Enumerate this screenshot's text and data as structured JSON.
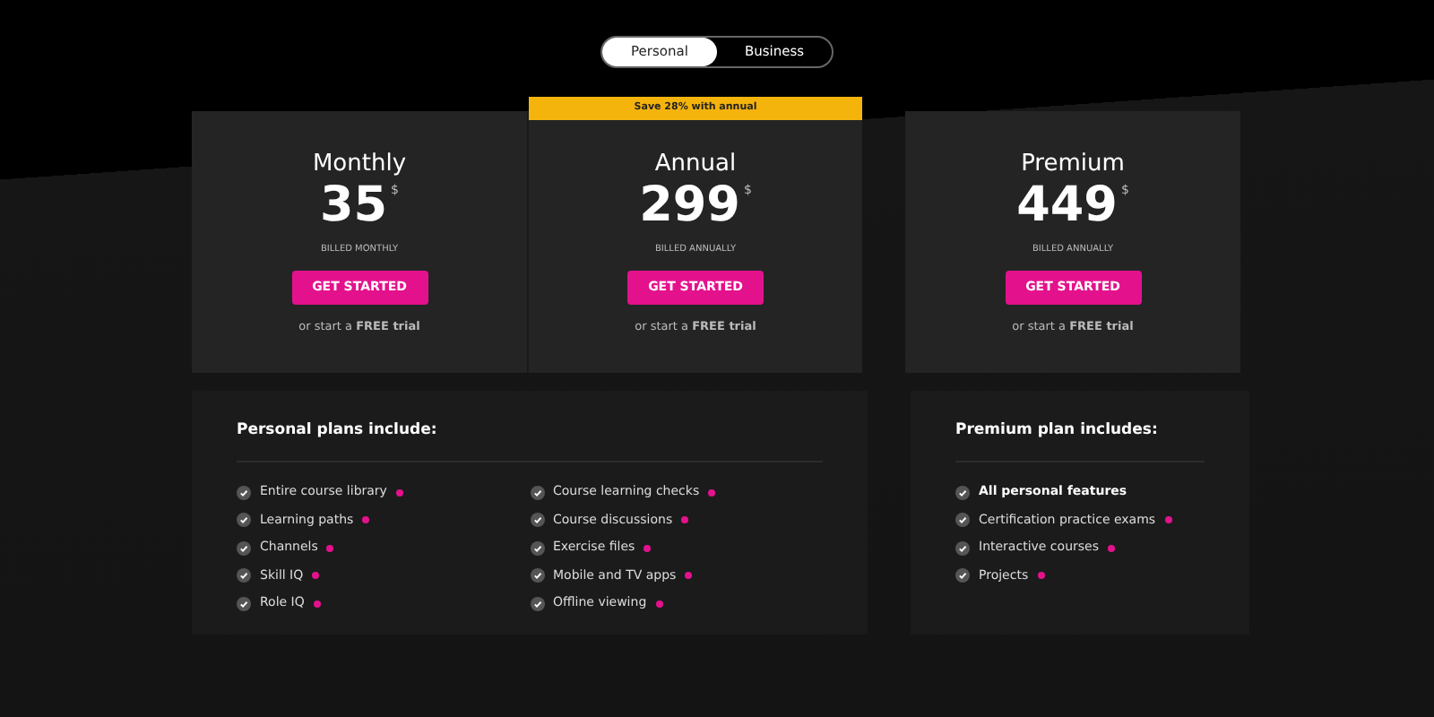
{
  "plan_toggle": [
    {
      "label": "Personal",
      "selected": true
    },
    {
      "label": "Business",
      "selected": false
    }
  ],
  "plans": [
    {
      "name": "Monthly",
      "price": "35",
      "currency": "$",
      "billing": "BILLED MONTHLY",
      "button": "GET STARTED",
      "trial_prefix": "or start a",
      "trial_link": "FREE trial"
    },
    {
      "name": "Annual",
      "banner": "Save 28% with annual",
      "price": "299",
      "currency": "$",
      "billing": "BILLED ANNUALLY",
      "button": "GET STARTED",
      "trial_prefix": "or start a",
      "trial_link": "FREE trial"
    },
    {
      "name": "Premium",
      "price": "449",
      "currency": "$",
      "billing": "BILLED ANNUALLY",
      "button": "GET STARTED",
      "trial_prefix": "or start a",
      "trial_link": "FREE trial"
    }
  ],
  "features": [
    {
      "title": "Personal plans include:",
      "columns": [
        [
          {
            "text": "Entire course library",
            "bold": false,
            "dot": true
          },
          {
            "text": "Learning paths",
            "bold": false,
            "dot": true
          },
          {
            "text": "Channels",
            "bold": false,
            "dot": true
          },
          {
            "text": "Skill IQ",
            "bold": false,
            "dot": true
          },
          {
            "text": "Role IQ",
            "bold": false,
            "dot": true
          }
        ],
        [
          {
            "text": "Course learning checks",
            "bold": false,
            "dot": true
          },
          {
            "text": "Course discussions",
            "bold": false,
            "dot": true
          },
          {
            "text": "Exercise files",
            "bold": false,
            "dot": true
          },
          {
            "text": "Mobile and TV apps",
            "bold": false,
            "dot": true
          },
          {
            "text": "Offline viewing",
            "bold": false,
            "dot": true
          }
        ]
      ]
    },
    {
      "title": "Premium plan includes:",
      "columns": [
        [
          {
            "text": "All personal features",
            "bold": true,
            "dot": false
          },
          {
            "text": "Certification practice exams",
            "bold": false,
            "dot": true
          },
          {
            "text": "Interactive courses",
            "bold": false,
            "dot": true
          },
          {
            "text": "Projects",
            "bold": false,
            "dot": true
          }
        ]
      ]
    }
  ]
}
